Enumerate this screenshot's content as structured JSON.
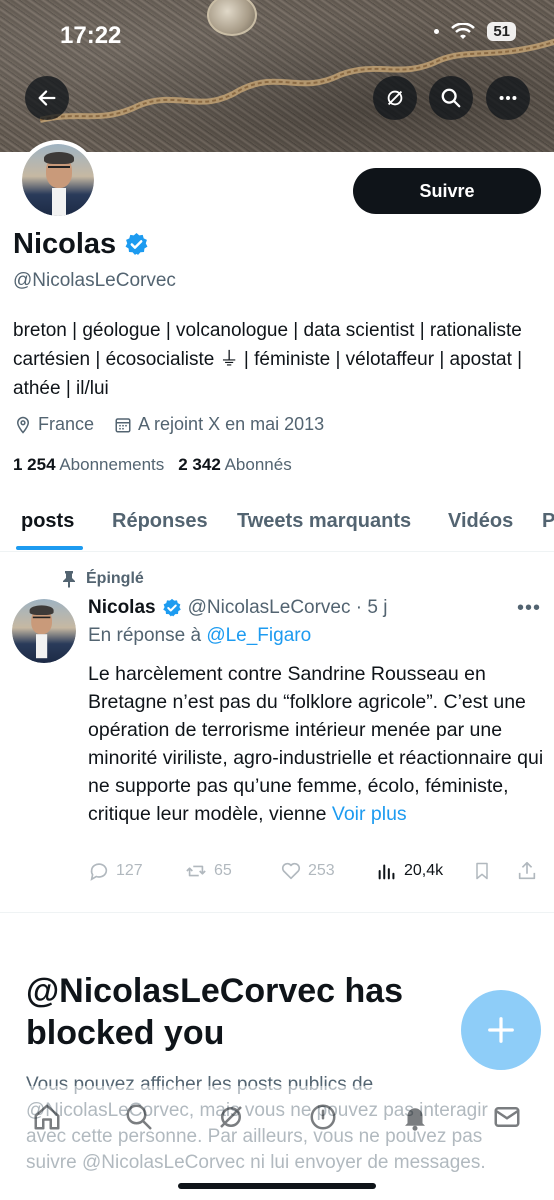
{
  "status_bar": {
    "time": "17:22",
    "battery": "51"
  },
  "profile": {
    "name": "Nicolas",
    "handle": "@NicolasLeCorvec",
    "follow_label": "Suivre",
    "bio": "breton | géologue | volcanologue | data scientist | rationaliste cartésien | écosocialiste ⏚ | féministe | vélotaffeur | apostat | athée | il/lui",
    "location": "France",
    "joined": "A rejoint X en mai 2013",
    "following_count": "1 254",
    "following_label": "Abonnements",
    "followers_count": "2 342",
    "followers_label": "Abonnés"
  },
  "tabs": [
    {
      "label": "posts"
    },
    {
      "label": "Réponses"
    },
    {
      "label": "Tweets marquants"
    },
    {
      "label": "Vidéos"
    },
    {
      "label": "P"
    }
  ],
  "pinned_post": {
    "pinned_label": "Épinglé",
    "author": "Nicolas",
    "handle_time": "@NicolasLeCorvec · 5 j",
    "reply_prefix": "En réponse à ",
    "reply_to": "@Le_Figaro",
    "text": "Le harcèlement contre Sandrine Rousseau en Bretagne n’est pas du “folklore agricole”. C’est une opération de terrorisme intérieur menée par une minorité viriliste, agro-industrielle et réactionnaire qui ne supporte pas qu’une femme, écolo, féministe, critique leur modèle, vienne ",
    "see_more": "Voir plus",
    "replies": "127",
    "reposts": "65",
    "likes": "253",
    "views": "20,4k"
  },
  "blocked": {
    "title": "@NicolasLeCorvec has blocked you",
    "description": "Vous pouvez afficher les posts publics de @NicolasLeCorvec, mais vous ne pouvez pas interagir avec cette personne. Par ailleurs, vous ne pouvez pas suivre @NicolasLeCorvec ni lui envoyer de messages."
  },
  "colors": {
    "accent": "#1d9bf0",
    "text": "#0f1419",
    "muted": "#536471",
    "fab": "#8ecdf8"
  }
}
